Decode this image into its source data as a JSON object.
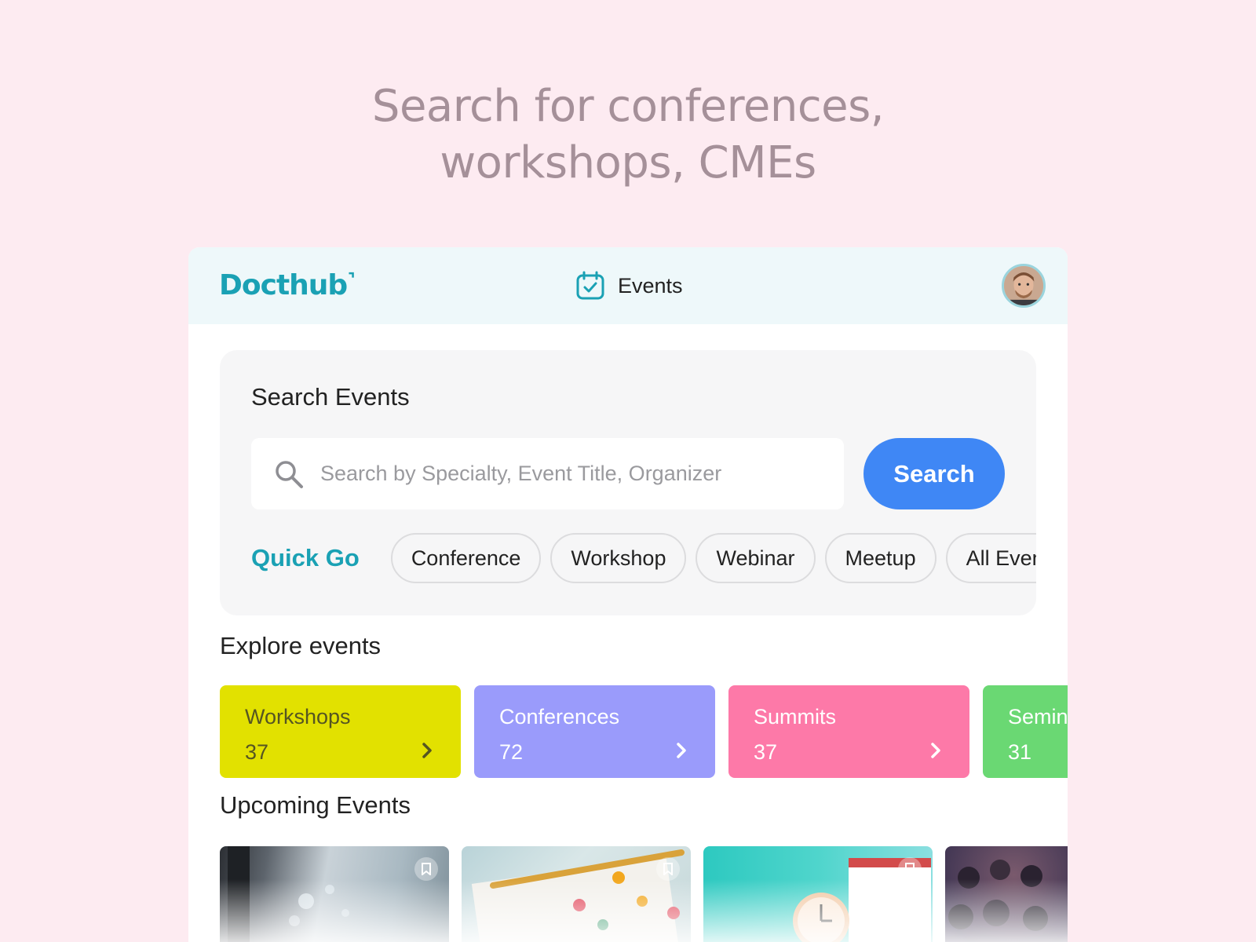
{
  "hero": {
    "line1": "Search for conferences,",
    "line2": "workshops, CMEs"
  },
  "header": {
    "logo": "Docthub",
    "logo_mark": "⌝",
    "nav_label": "Events",
    "nav_icon": "calendar-check-icon",
    "avatar_icon": "user-avatar"
  },
  "search": {
    "title": "Search Events",
    "placeholder": "Search by Specialty, Event Title, Organizer",
    "value": "",
    "button_label": "Search",
    "icon": "search-icon"
  },
  "quick_go": {
    "label": "Quick Go",
    "chips": [
      "Conference",
      "Workshop",
      "Webinar",
      "Meetup",
      "All Events"
    ]
  },
  "explore": {
    "title": "Explore events",
    "categories": [
      {
        "name": "Workshops",
        "count": "37",
        "bg": "#e2e100",
        "fg": "#555522"
      },
      {
        "name": "Conferences",
        "count": "72",
        "bg": "#9a9bfb",
        "fg": "#ffffff"
      },
      {
        "name": "Summits",
        "count": "37",
        "bg": "#fd79a8",
        "fg": "#ffffff"
      },
      {
        "name": "Seminars",
        "count": "31",
        "bg": "#6ad873",
        "fg": "#ffffff"
      }
    ]
  },
  "upcoming": {
    "title": "Upcoming Events",
    "bookmark_icon": "bookmark-icon"
  },
  "colors": {
    "brand": "#1aa1b4",
    "primary_button": "#3f87f5",
    "page_bg": "#fdebf1"
  }
}
